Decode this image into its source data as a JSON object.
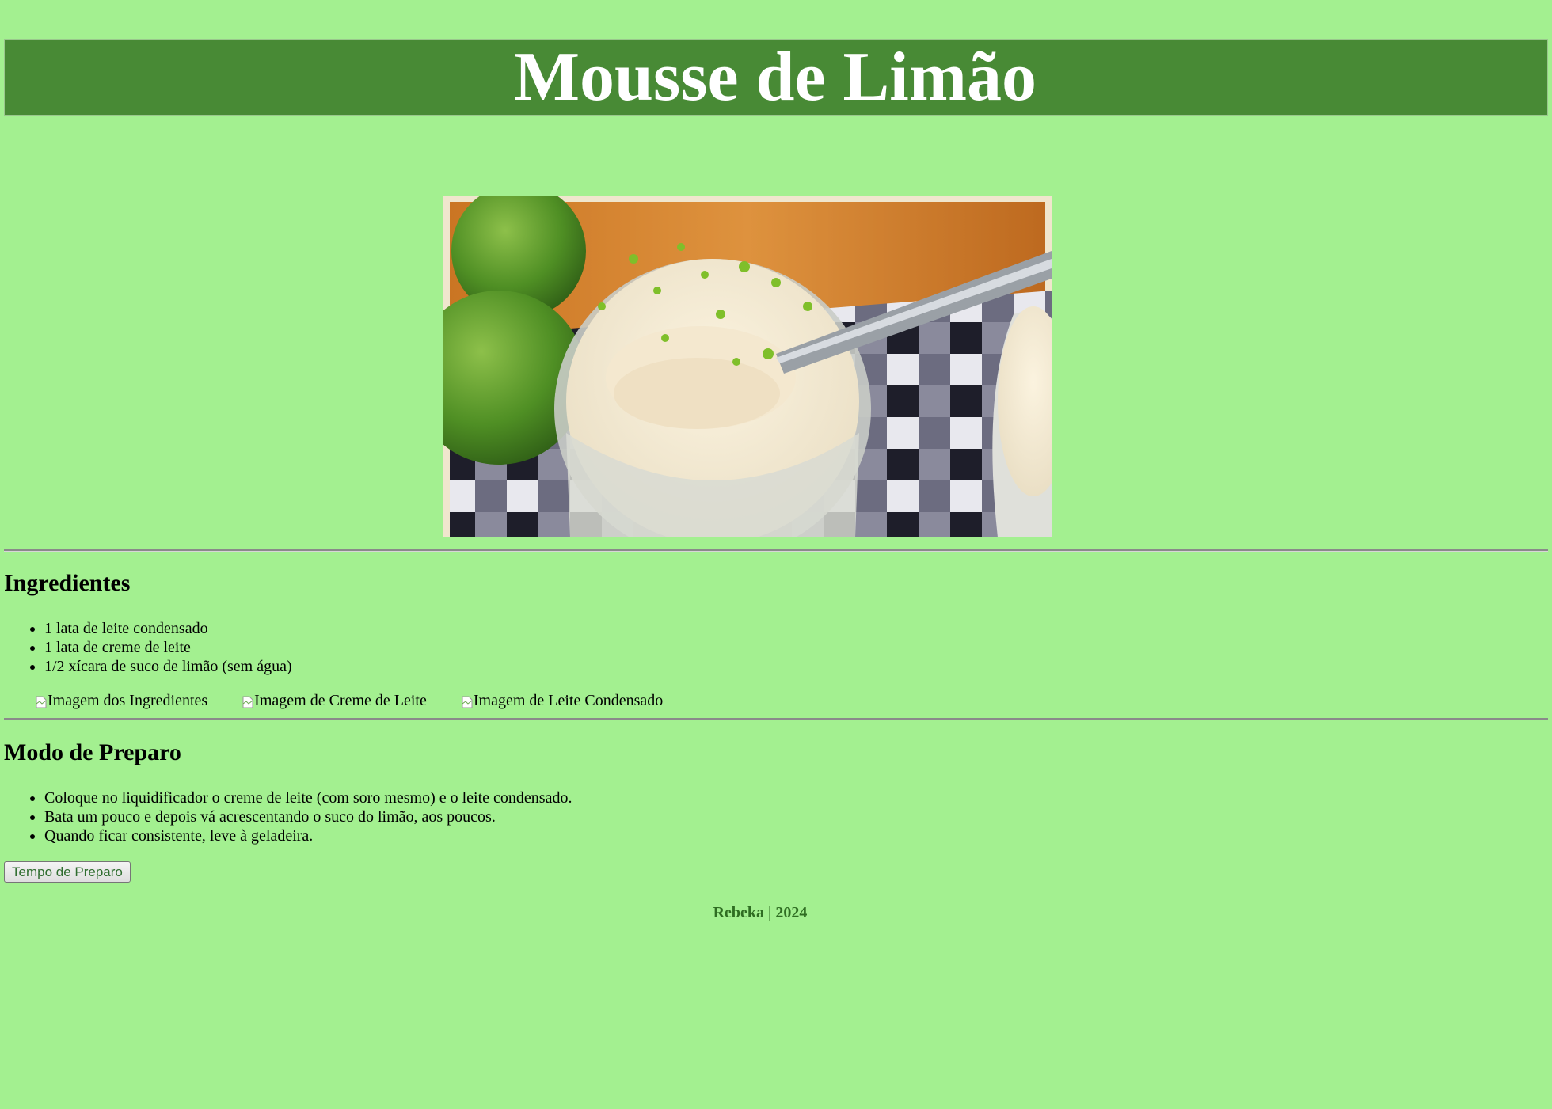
{
  "header": {
    "title": "Mousse de Limão"
  },
  "hero_image": {
    "alt": "Mousse de limão"
  },
  "ingredients": {
    "heading": "Ingredientes",
    "items": [
      "1 lata de leite condensado",
      "1 lata de creme de leite",
      "1/2 xícara de suco de limão (sem água)"
    ],
    "images": [
      "Imagem dos Ingredientes",
      "Imagem de Creme de Leite",
      "Imagem de Leite Condensado"
    ]
  },
  "preparation": {
    "heading": "Modo de Preparo",
    "steps": [
      "Coloque no liquidificador o creme de leite (com soro mesmo) e o leite condensado.",
      "Bata um pouco e depois vá acrescentando o suco do limão, aos poucos.",
      "Quando ficar consistente, leve à geladeira."
    ],
    "button_label": "Tempo de Preparo"
  },
  "footer": {
    "text": "Rebeka | 2024"
  },
  "colors": {
    "page_background": "#a3f090",
    "title_bar": "#488a35",
    "footer_text": "#2f6d22"
  }
}
